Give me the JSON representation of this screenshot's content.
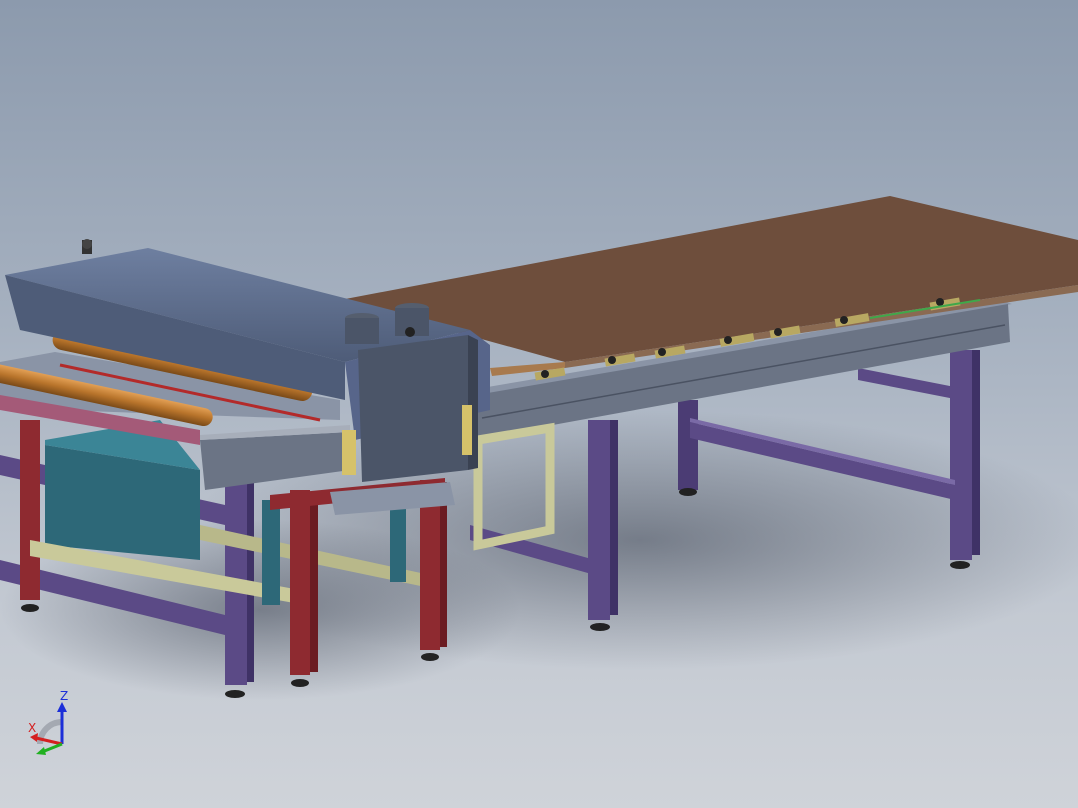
{
  "viewport": {
    "background_top": "#8c9aad",
    "background_bottom": "#cfd3d9"
  },
  "triad": {
    "z_label": "Z",
    "x_label": "X",
    "y_label": "",
    "z_color": "#1c2fd8",
    "x_color": "#d42020",
    "y_color": "#21b021"
  },
  "colors": {
    "board_top": "#6e4e3c",
    "board_edge": "#8a6a52",
    "rail": "#6b7485",
    "leg_purple": "#5b4a86",
    "leg_red": "#8e2a30",
    "frame_yellow": "#c9c99a",
    "housing": "#5a6a86",
    "roller_orange": "#b8742b",
    "teal": "#2d6878"
  }
}
